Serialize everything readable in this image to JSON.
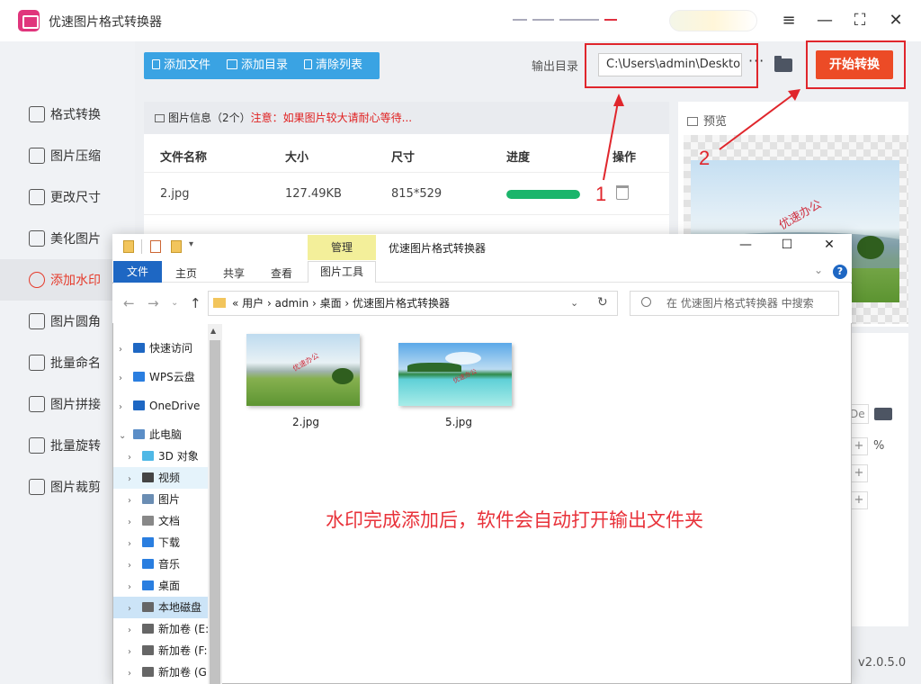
{
  "app": {
    "title": "优速图片格式转换器",
    "window_controls": [
      "≡",
      "—",
      "⛶",
      "✕"
    ]
  },
  "sidebar": {
    "items": [
      {
        "label": "格式转换",
        "icon": "convert-icon"
      },
      {
        "label": "图片压缩",
        "icon": "compress-icon"
      },
      {
        "label": "更改尺寸",
        "icon": "resize-icon"
      },
      {
        "label": "美化图片",
        "icon": "beautify-icon"
      },
      {
        "label": "添加水印",
        "icon": "watermark-icon",
        "active": true
      },
      {
        "label": "图片圆角",
        "icon": "round-corner-icon"
      },
      {
        "label": "批量命名",
        "icon": "rename-icon"
      },
      {
        "label": "图片拼接",
        "icon": "stitch-icon"
      },
      {
        "label": "批量旋转",
        "icon": "rotate-icon"
      },
      {
        "label": "图片裁剪",
        "icon": "crop-icon"
      }
    ]
  },
  "toolbar": {
    "add_file": "添加文件",
    "add_dir": "添加目录",
    "clear_list": "清除列表",
    "output_label": "输出目录",
    "output_path": "C:\\Users\\admin\\Desktop",
    "more": "···",
    "start": "开始转换"
  },
  "file_list": {
    "info": "图片信息（2个）",
    "warning": "注意：如果图片较大请耐心等待...",
    "headers": [
      "文件名称",
      "大小",
      "尺寸",
      "进度",
      "操作"
    ],
    "rows": [
      {
        "name": "2.jpg",
        "size": "127.49KB",
        "dims": "815*529",
        "progress": 1.0
      }
    ]
  },
  "preview": {
    "title": "预览",
    "watermark_text": "优速办公"
  },
  "settings": {
    "input_value": "De",
    "unit": "%",
    "plus": "+"
  },
  "version": "v2.0.5.0",
  "annotations": {
    "n1": "1",
    "n2": "2",
    "notice": "水印完成添加后，软件会自动打开输出文件夹",
    "color": "#e0262c"
  },
  "explorer": {
    "context_tab": "管理",
    "title": "优速图片格式转换器",
    "tabs": {
      "file": "文件",
      "home": "主页",
      "share": "共享",
      "view": "查看",
      "tools": "图片工具"
    },
    "help": "?",
    "breadcrumb": "«  用户  ›  admin  ›  桌面  ›  优速图片格式转换器",
    "search_placeholder": "在 优速图片格式转换器 中搜索",
    "tree": [
      {
        "label": "快速访问",
        "chev": "›",
        "color": "#1e67c3"
      },
      {
        "label": "WPS云盘",
        "chev": "›",
        "color": "#2a7ee0"
      },
      {
        "label": "OneDrive",
        "chev": "›",
        "color": "#1e67c3"
      },
      {
        "label": "此电脑",
        "chev": "⌄",
        "color": "#5b8ec7"
      },
      {
        "label": "3D 对象",
        "chev": "›",
        "color": "#4fb8e6",
        "indent": true
      },
      {
        "label": "视频",
        "chev": "›",
        "color": "#444",
        "indent": true,
        "hl": true
      },
      {
        "label": "图片",
        "chev": "›",
        "color": "#6a8db3",
        "indent": true
      },
      {
        "label": "文档",
        "chev": "›",
        "color": "#888",
        "indent": true
      },
      {
        "label": "下载",
        "chev": "›",
        "color": "#2a7ee0",
        "indent": true
      },
      {
        "label": "音乐",
        "chev": "›",
        "color": "#2a7ee0",
        "indent": true
      },
      {
        "label": "桌面",
        "chev": "›",
        "color": "#2a7ee0",
        "indent": true
      },
      {
        "label": "本地磁盘",
        "chev": "›",
        "color": "#666",
        "indent": true,
        "sel": true
      },
      {
        "label": "新加卷 (E:",
        "chev": "›",
        "color": "#666",
        "indent": true
      },
      {
        "label": "新加卷 (F:",
        "chev": "›",
        "color": "#666",
        "indent": true
      },
      {
        "label": "新加卷 (G",
        "chev": "›",
        "color": "#666",
        "indent": true
      }
    ],
    "files": [
      "2.jpg",
      "5.jpg"
    ]
  }
}
